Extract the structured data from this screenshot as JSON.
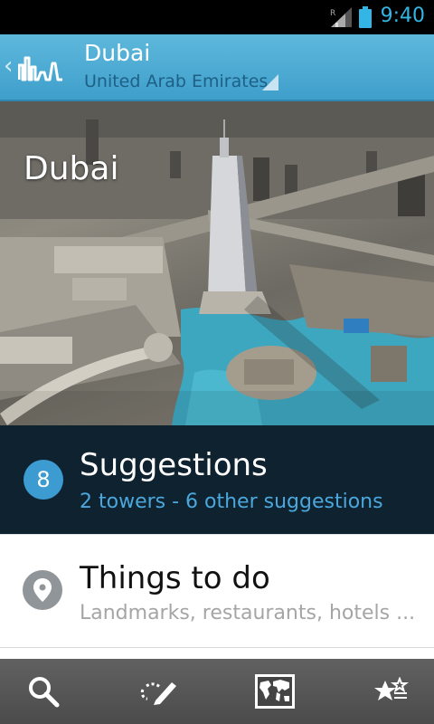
{
  "status_bar": {
    "time": "9:40",
    "roaming_indicator": "R",
    "icons": [
      "signal-icon",
      "battery-icon"
    ]
  },
  "action_bar": {
    "title": "Dubai",
    "subtitle": "United Arab Emirates",
    "icons": [
      "back-chevron-icon",
      "skyline-logo-icon",
      "spinner-arrow-icon"
    ]
  },
  "hero": {
    "title": "Dubai"
  },
  "suggestions": {
    "count": "8",
    "title": "Suggestions",
    "subtitle": "2 towers - 6 other suggestions"
  },
  "things_to_do": {
    "title": "Things to do",
    "subtitle": "Landmarks, restaurants, hotels ...",
    "icon": "location-pin-icon"
  },
  "bottom_bar": {
    "icons": [
      "search-icon",
      "edit-note-icon",
      "world-map-icon",
      "favorites-stars-icon"
    ]
  },
  "colors": {
    "accent": "#33b5e5",
    "action_bar": "#4aa8d4",
    "suggestions_bg": "#0f2230",
    "suggestions_sub": "#4aa8dd",
    "subtitle_dark": "#1e5f86"
  }
}
